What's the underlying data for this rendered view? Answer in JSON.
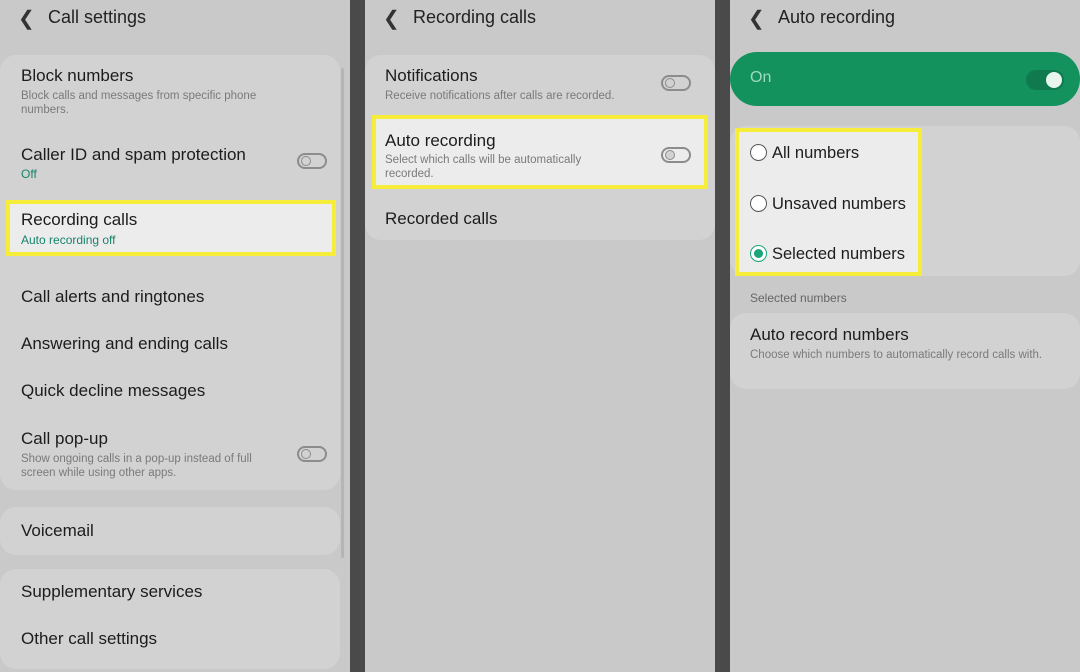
{
  "panel1": {
    "title": "Call settings",
    "items": [
      {
        "title": "Block numbers",
        "subtitle": "Block calls and messages from specific phone numbers."
      },
      {
        "title": "Caller ID and spam protection",
        "status": "Off"
      },
      {
        "title": "Recording calls",
        "status": "Auto recording off"
      },
      {
        "title": "Call alerts and ringtones"
      },
      {
        "title": "Answering and ending calls"
      },
      {
        "title": "Quick decline messages"
      },
      {
        "title": "Call pop-up",
        "subtitle": "Show ongoing calls in a pop-up instead of full screen while using other apps."
      },
      {
        "title": "Voicemail"
      },
      {
        "title": "Supplementary services"
      },
      {
        "title": "Other call settings"
      }
    ]
  },
  "panel2": {
    "title": "Recording calls",
    "items": [
      {
        "title": "Notifications",
        "subtitle": "Receive notifications after calls are recorded."
      },
      {
        "title": "Auto recording",
        "subtitle": "Select which calls will be automatically recorded."
      },
      {
        "title": "Recorded calls"
      }
    ]
  },
  "panel3": {
    "title": "Auto recording",
    "master": {
      "label": "On",
      "state": "on"
    },
    "options": [
      {
        "label": "All numbers",
        "selected": false
      },
      {
        "label": "Unsaved numbers",
        "selected": false
      },
      {
        "label": "Selected numbers",
        "selected": true
      }
    ],
    "section_label": "Selected numbers",
    "auto_record": {
      "title": "Auto record numbers",
      "subtitle": "Choose which numbers to automatically record calls with."
    }
  },
  "colors": {
    "accent_green": "#14925d",
    "radio_green": "#1aa57a",
    "highlight": "#f6ec3a",
    "status_teal": "#18836b"
  }
}
